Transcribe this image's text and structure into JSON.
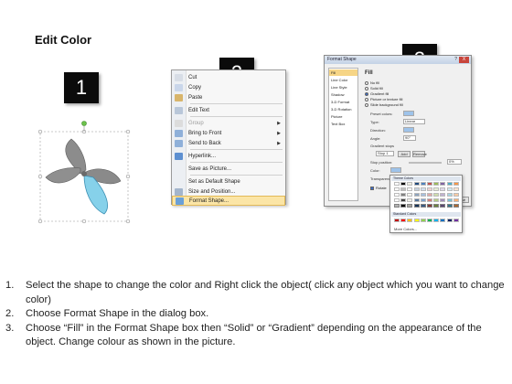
{
  "page": {
    "title": "Edit Color"
  },
  "badges": [
    "1",
    "2",
    "3"
  ],
  "context_menu": {
    "items": [
      {
        "label": "Cut",
        "icon": "scissors-icon",
        "enabled": true,
        "submenu": false
      },
      {
        "label": "Copy",
        "icon": "copy-icon",
        "enabled": true,
        "submenu": false
      },
      {
        "label": "Paste",
        "icon": "paste-icon",
        "enabled": true,
        "submenu": false
      },
      {
        "label": "Edit Text",
        "icon": "edit-text-icon",
        "enabled": true,
        "submenu": false
      },
      {
        "label": "Group",
        "icon": "group-icon",
        "enabled": false,
        "submenu": true
      },
      {
        "label": "Bring to Front",
        "icon": "bring-front-icon",
        "enabled": true,
        "submenu": true
      },
      {
        "label": "Send to Back",
        "icon": "send-back-icon",
        "enabled": true,
        "submenu": true
      },
      {
        "label": "Hyperlink...",
        "icon": "hyperlink-icon",
        "enabled": true,
        "submenu": false
      },
      {
        "label": "Save as Picture...",
        "icon": "",
        "enabled": true,
        "submenu": false
      },
      {
        "label": "Set as Default Shape",
        "icon": "",
        "enabled": true,
        "submenu": false
      },
      {
        "label": "Size and Position...",
        "icon": "size-position-icon",
        "enabled": true,
        "submenu": false
      },
      {
        "label": "Format Shape...",
        "icon": "format-shape-icon",
        "enabled": true,
        "submenu": false,
        "highlighted": true
      }
    ]
  },
  "dialog": {
    "title": "Format Shape",
    "help": "?",
    "close": "X",
    "nav": [
      "Fill",
      "Line Color",
      "Line Style",
      "Shadow",
      "3-D Format",
      "3-D Rotation",
      "Picture",
      "Text Box"
    ],
    "fill_heading": "Fill",
    "options": [
      "No fill",
      "Solid fill",
      "Gradient fill",
      "Picture or texture fill",
      "Slide background fill"
    ],
    "selected_option": "Gradient fill",
    "fields": {
      "preset_colors": "Preset colors:",
      "type": "Type:",
      "type_value": "Linear",
      "direction": "Direction:",
      "angle": "Angle:",
      "angle_value": "90°",
      "gradient_stops": "Gradient stops",
      "stop_value": "Stop 1",
      "add": "Add",
      "remove": "Remove",
      "stop_position": "Stop position:",
      "stop_position_value": "0%",
      "color": "Color:",
      "transparency": "Transparency:",
      "rotate_with_shape": "Rotate"
    },
    "close_button": "Close"
  },
  "color_picker": {
    "theme_header": "Theme Colors",
    "standard_header": "Standard Colors",
    "more": "More Colors...",
    "theme_top": [
      "#ffffff",
      "#000000",
      "#eeece1",
      "#1f497d",
      "#4f81bd",
      "#c0504d",
      "#9bbb59",
      "#8064a2",
      "#4bacc6",
      "#f79646"
    ],
    "standard": [
      "#c00000",
      "#ff0000",
      "#ffc000",
      "#ffff00",
      "#92d050",
      "#00b050",
      "#00b0f0",
      "#0070c0",
      "#002060",
      "#7030a0"
    ]
  },
  "instructions": [
    {
      "num": "1.",
      "text": "Select the shape to change the color and Right click the object( click any object which you want to change color)"
    },
    {
      "num": "2.",
      "text": "Choose Format Shape in the dialog box."
    },
    {
      "num": "3.",
      "text": "Choose “Fill” in the Format Shape box then “Solid” or “Gradient” depending on the appearance of the object. Change colour as shown in the picture."
    }
  ]
}
